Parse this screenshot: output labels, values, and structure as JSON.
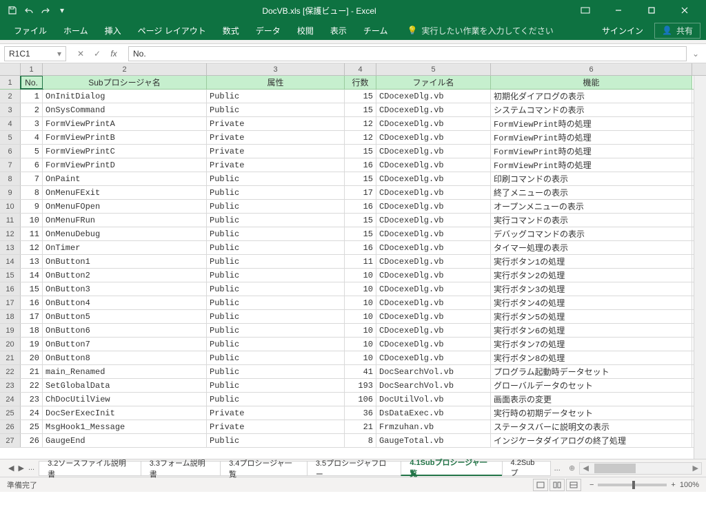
{
  "title": "DocVB.xls [保護ビュー] - Excel",
  "qat": {
    "save": "save",
    "undo": "undo",
    "redo": "redo",
    "customize": "customize"
  },
  "ribbon": {
    "tabs": [
      "ファイル",
      "ホーム",
      "挿入",
      "ページ レイアウト",
      "数式",
      "データ",
      "校閲",
      "表示",
      "チーム"
    ],
    "tell": "実行したい作業を入力してください",
    "signin": "サインイン",
    "share": "共有"
  },
  "namebox": "R1C1",
  "formula": "No.",
  "colHeaders": [
    "1",
    "2",
    "3",
    "4",
    "5",
    "6"
  ],
  "table": {
    "headers": [
      "No.",
      "Subプロシージャ名",
      "属性",
      "行数",
      "ファイル名",
      "機能"
    ],
    "rows": [
      [
        1,
        "OnInitDialog",
        "Public",
        15,
        "CDocexeDlg.vb",
        "初期化ダイアログの表示"
      ],
      [
        2,
        "OnSysCommand",
        "Public",
        15,
        "CDocexeDlg.vb",
        "システムコマンドの表示"
      ],
      [
        3,
        "FormViewPrintA",
        "Private",
        12,
        "CDocexeDlg.vb",
        "FormViewPrint時の処理"
      ],
      [
        4,
        "FormViewPrintB",
        "Private",
        12,
        "CDocexeDlg.vb",
        "FormViewPrint時の処理"
      ],
      [
        5,
        "FormViewPrintC",
        "Private",
        15,
        "CDocexeDlg.vb",
        "FormViewPrint時の処理"
      ],
      [
        6,
        "FormViewPrintD",
        "Private",
        16,
        "CDocexeDlg.vb",
        "FormViewPrint時の処理"
      ],
      [
        7,
        "OnPaint",
        "Public",
        15,
        "CDocexeDlg.vb",
        "印刷コマンドの表示"
      ],
      [
        8,
        "OnMenuFExit",
        "Public",
        17,
        "CDocexeDlg.vb",
        "終了メニューの表示"
      ],
      [
        9,
        "OnMenuFOpen",
        "Public",
        16,
        "CDocexeDlg.vb",
        "オープンメニューの表示"
      ],
      [
        10,
        "OnMenuFRun",
        "Public",
        15,
        "CDocexeDlg.vb",
        "実行コマンドの表示"
      ],
      [
        11,
        "OnMenuDebug",
        "Public",
        15,
        "CDocexeDlg.vb",
        "デバッグコマンドの表示"
      ],
      [
        12,
        "OnTimer",
        "Public",
        16,
        "CDocexeDlg.vb",
        "タイマー処理の表示"
      ],
      [
        13,
        "OnButton1",
        "Public",
        11,
        "CDocexeDlg.vb",
        "実行ボタン1の処理"
      ],
      [
        14,
        "OnButton2",
        "Public",
        10,
        "CDocexeDlg.vb",
        "実行ボタン2の処理"
      ],
      [
        15,
        "OnButton3",
        "Public",
        10,
        "CDocexeDlg.vb",
        "実行ボタン3の処理"
      ],
      [
        16,
        "OnButton4",
        "Public",
        10,
        "CDocexeDlg.vb",
        "実行ボタン4の処理"
      ],
      [
        17,
        "OnButton5",
        "Public",
        10,
        "CDocexeDlg.vb",
        "実行ボタン5の処理"
      ],
      [
        18,
        "OnButton6",
        "Public",
        10,
        "CDocexeDlg.vb",
        "実行ボタン6の処理"
      ],
      [
        19,
        "OnButton7",
        "Public",
        10,
        "CDocexeDlg.vb",
        "実行ボタン7の処理"
      ],
      [
        20,
        "OnButton8",
        "Public",
        10,
        "CDocexeDlg.vb",
        "実行ボタン8の処理"
      ],
      [
        21,
        "main_Renamed",
        "Public",
        41,
        "DocSearchVol.vb",
        "プログラム起動時データセット"
      ],
      [
        22,
        "SetGlobalData",
        "Public",
        193,
        "DocSearchVol.vb",
        "グローバルデータのセット"
      ],
      [
        23,
        "ChDocUtilView",
        "Public",
        106,
        "DocUtilVol.vb",
        "画面表示の変更"
      ],
      [
        24,
        "DocSerExecInit",
        "Private",
        36,
        "DsDataExec.vb",
        "実行時の初期データセット"
      ],
      [
        25,
        "MsgHook1_Message",
        "Private",
        21,
        "Frmzuhan.vb",
        "ステータスバーに説明文の表示"
      ],
      [
        26,
        "GaugeEnd",
        "Public",
        8,
        "GaugeTotal.vb",
        "インジケータダイアログの終了処理"
      ]
    ]
  },
  "sheets": {
    "navMore": "...",
    "tabs": [
      "3.2ソースファイル説明書",
      "3.3フォーム説明書",
      "3.4プロシージャ一覧",
      "3.5プロシージャフロー",
      "4.1Subプロシージャ一覧",
      "4.2Subプ"
    ],
    "active": 4,
    "more": "..."
  },
  "status": {
    "ready": "準備完了",
    "zoom": "100%"
  }
}
